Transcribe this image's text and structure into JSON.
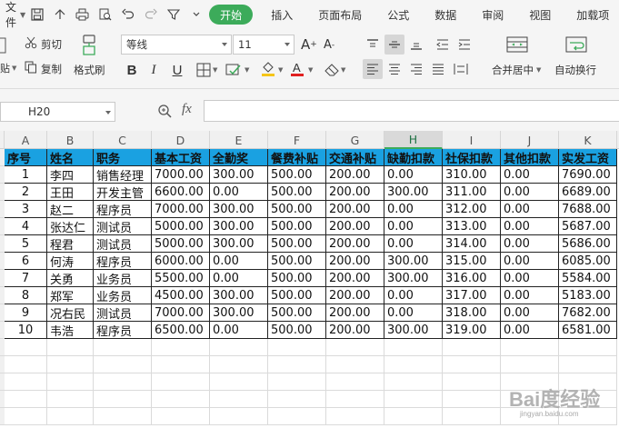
{
  "menubar": {
    "file_label": "文件",
    "tabs": [
      "开始",
      "插入",
      "页面布局",
      "公式",
      "数据",
      "审阅",
      "视图",
      "加载项"
    ]
  },
  "ribbon": {
    "cut_label": "剪切",
    "copy_label": "复制",
    "format_painter_label": "格式刷",
    "paste_fragment": "贴",
    "font_name": "等线",
    "font_size": "11",
    "merge_center_label": "合并居中",
    "wrap_text_label": "自动换行",
    "bold": "B",
    "italic": "I",
    "underline": "U"
  },
  "formula_bar": {
    "cell_ref": "H20",
    "fx": "fx",
    "formula": ""
  },
  "columns": [
    "A",
    "B",
    "C",
    "D",
    "E",
    "F",
    "G",
    "H",
    "I",
    "J",
    "K"
  ],
  "selected_column": "H",
  "table": {
    "headers": [
      "序号",
      "姓名",
      "职务",
      "基本工资",
      "全勤奖",
      "餐费补贴",
      "交通补贴",
      "缺勤扣款",
      "社保扣款",
      "其他扣款",
      "实发工资"
    ],
    "rows": [
      [
        "1",
        "李四",
        "销售经理",
        "7000.00",
        "300.00",
        "500.00",
        "200.00",
        "0.00",
        "310.00",
        "0.00",
        "7690.00"
      ],
      [
        "2",
        "王田",
        "开发主管",
        "6600.00",
        "0.00",
        "500.00",
        "200.00",
        "300.00",
        "311.00",
        "0.00",
        "6689.00"
      ],
      [
        "3",
        "赵二",
        "程序员",
        "7000.00",
        "300.00",
        "500.00",
        "200.00",
        "0.00",
        "312.00",
        "0.00",
        "7688.00"
      ],
      [
        "4",
        "张达仁",
        "测试员",
        "5000.00",
        "300.00",
        "500.00",
        "200.00",
        "0.00",
        "313.00",
        "0.00",
        "5687.00"
      ],
      [
        "5",
        "程君",
        "测试员",
        "5000.00",
        "300.00",
        "500.00",
        "200.00",
        "0.00",
        "314.00",
        "0.00",
        "5686.00"
      ],
      [
        "6",
        "何涛",
        "程序员",
        "6000.00",
        "0.00",
        "500.00",
        "200.00",
        "300.00",
        "315.00",
        "0.00",
        "6085.00"
      ],
      [
        "7",
        "关勇",
        "业务员",
        "5500.00",
        "0.00",
        "500.00",
        "200.00",
        "300.00",
        "316.00",
        "0.00",
        "5584.00"
      ],
      [
        "8",
        "郑军",
        "业务员",
        "4500.00",
        "300.00",
        "500.00",
        "200.00",
        "0.00",
        "317.00",
        "0.00",
        "5183.00"
      ],
      [
        "9",
        "况右民",
        "测试员",
        "7000.00",
        "300.00",
        "500.00",
        "200.00",
        "0.00",
        "318.00",
        "0.00",
        "7682.00"
      ],
      [
        "10",
        "韦浩",
        "程序员",
        "6500.00",
        "0.00",
        "500.00",
        "200.00",
        "300.00",
        "319.00",
        "0.00",
        "6581.00"
      ]
    ]
  },
  "watermark": {
    "brand": "Bai度经验",
    "url": "jingyan.baidu.com"
  },
  "colors": {
    "header_fill": "#1aa1e1",
    "accent_green": "#3cab5a"
  }
}
